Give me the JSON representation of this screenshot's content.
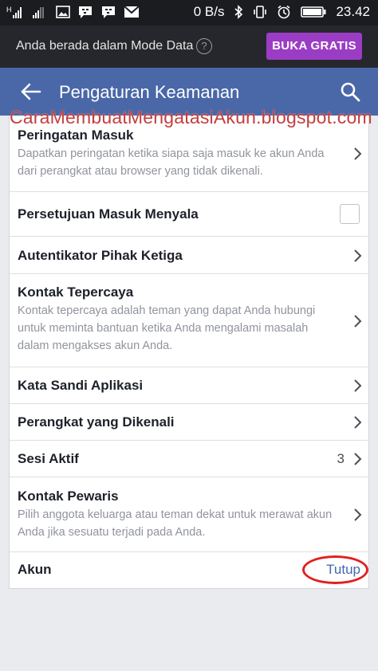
{
  "status_bar": {
    "net_speed": "0 B/s",
    "time": "23.42",
    "icons": [
      "signal-h-icon",
      "signal-icon",
      "image-icon",
      "bbm-icon",
      "bbm-icon",
      "gmail-icon",
      "bluetooth-icon",
      "vibrate-icon",
      "alarm-icon",
      "battery-icon"
    ]
  },
  "data_banner": {
    "message": "Anda berada dalam Mode Data",
    "help": "?",
    "button": "BUKA GRATIS",
    "button_color": "#9b3dc4"
  },
  "app_bar": {
    "title": "Pengaturan Keamanan",
    "color": "#4a68a8"
  },
  "watermark": "CaraMembuatMengatasiAkun.blogspot.com",
  "settings": {
    "peringatan": {
      "label": "Peringatan Masuk",
      "desc": "Dapatkan peringatan ketika siapa saja masuk ke akun Anda dari perangkat atau browser yang tidak dikenali."
    },
    "persetujuan": {
      "label": "Persetujuan Masuk Menyala",
      "checked": false
    },
    "autentikator": {
      "label": "Autentikator Pihak Ketiga"
    },
    "kontak": {
      "label": "Kontak Tepercaya",
      "desc": "Kontak tepercaya adalah teman yang dapat Anda hubungi untuk meminta bantuan ketika Anda mengalami masalah dalam mengakses akun Anda."
    },
    "sandi": {
      "label": "Kata Sandi Aplikasi"
    },
    "perangkat": {
      "label": "Perangkat yang Dikenali"
    },
    "sesi": {
      "label": "Sesi Aktif",
      "count": "3"
    },
    "pewaris": {
      "label": "Kontak Pewaris",
      "desc": "Pilih anggota keluarga atau teman dekat untuk merawat akun Anda jika sesuatu terjadi pada Anda."
    },
    "akun": {
      "label": "Akun",
      "action": "Tutup"
    }
  }
}
